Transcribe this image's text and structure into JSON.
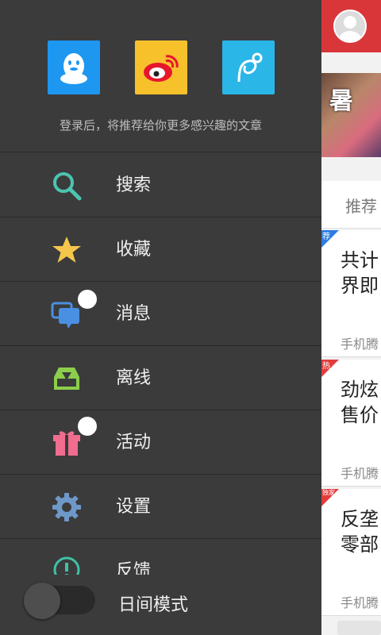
{
  "drawer": {
    "login": {
      "providers": [
        {
          "name": "qq",
          "icon": "qq-penguin-icon",
          "color": "#1e97f0"
        },
        {
          "name": "weibo",
          "icon": "weibo-icon",
          "color": "#f7c12c"
        },
        {
          "name": "tencent-weibo",
          "icon": "tencent-weibo-icon",
          "color": "#2bb6e8"
        }
      ],
      "tip": "登录后，将推荐给你更多感兴趣的文章"
    },
    "menu": [
      {
        "label": "搜索",
        "icon": "search-icon",
        "color": "#4cc4b0"
      },
      {
        "label": "收藏",
        "icon": "star-icon",
        "color": "#f5c64c"
      },
      {
        "label": "消息",
        "icon": "message-icon",
        "color": "#4a90e2",
        "badge": true
      },
      {
        "label": "离线",
        "icon": "offline-download-icon",
        "color": "#8ccf4c"
      },
      {
        "label": "活动",
        "icon": "gift-icon",
        "color": "#f06d8f",
        "badge": true
      },
      {
        "label": "设置",
        "icon": "gear-icon",
        "color": "#6e98c8"
      },
      {
        "label": "反馈",
        "icon": "feedback-icon",
        "color": "#3fc1a5"
      }
    ],
    "night_mode": {
      "label": "日间模式",
      "enabled": false
    }
  },
  "content": {
    "banner_text": "暑",
    "tab_label": "推荐",
    "cards": [
      {
        "tag": "荐",
        "tag_color": "#2d7ce2",
        "title": "共计界即",
        "source": "手机腾"
      },
      {
        "tag": "热",
        "tag_color": "#e23d3d",
        "title": "劲炫售价",
        "source": "手机腾"
      },
      {
        "tag": "独家",
        "tag_color": "#e23d3d",
        "title": "反垄零部",
        "source": "手机腾"
      }
    ]
  }
}
